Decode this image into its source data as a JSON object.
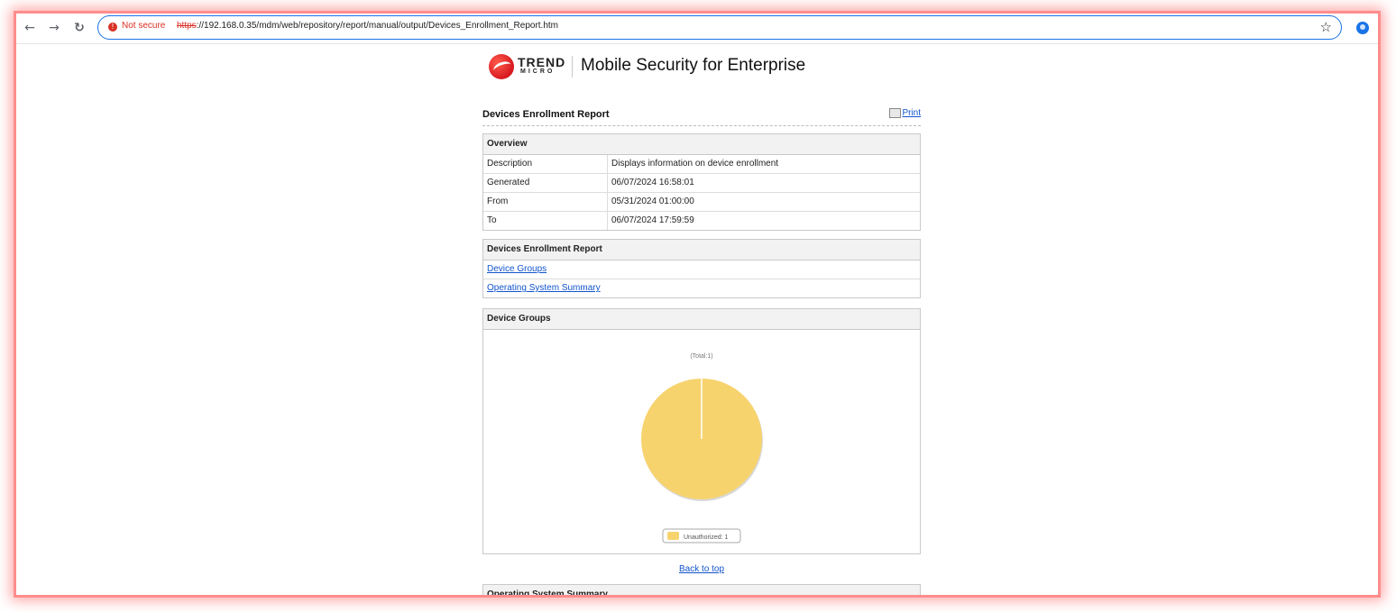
{
  "browser": {
    "security_label": "Not secure",
    "url_scheme": "https",
    "url_rest": "://192.168.0.35/mdm/web/repository/report/manual/output/Devices_Enrollment_Report.htm",
    "icons": [
      "back-arrow-icon",
      "forward-arrow-icon",
      "reload-icon",
      "warning-icon",
      "star-icon",
      "profile-icon"
    ]
  },
  "brand": {
    "logo_word": "TREND",
    "logo_sub": "MICRO",
    "product": "Mobile Security for Enterprise"
  },
  "report": {
    "title": "Devices Enrollment Report",
    "print_label": "Print"
  },
  "overview": {
    "heading": "Overview",
    "rows": [
      {
        "label": "Description",
        "value": "Displays information on device enrollment"
      },
      {
        "label": "Generated",
        "value": "06/07/2024 16:58:01"
      },
      {
        "label": "From",
        "value": "05/31/2024 01:00:00"
      },
      {
        "label": "To",
        "value": "06/07/2024 17:59:59"
      }
    ]
  },
  "contents": {
    "heading": "Devices Enrollment Report",
    "links": [
      "Device Groups",
      "Operating System Summary"
    ]
  },
  "device_groups": {
    "heading": "Device Groups",
    "back_to_top": "Back to top"
  },
  "os_summary": {
    "heading": "Operating System Summary"
  },
  "colors": {
    "pie_fill": "#f7d36e",
    "link": "#1155cc",
    "not_secure": "#d93025"
  },
  "chart_data": {
    "type": "pie",
    "title": "(Total:1)",
    "categories": [
      "Unauthorized"
    ],
    "values": [
      1
    ],
    "legend_labels": [
      "Unauthorized: 1"
    ],
    "legend": "bottom"
  }
}
